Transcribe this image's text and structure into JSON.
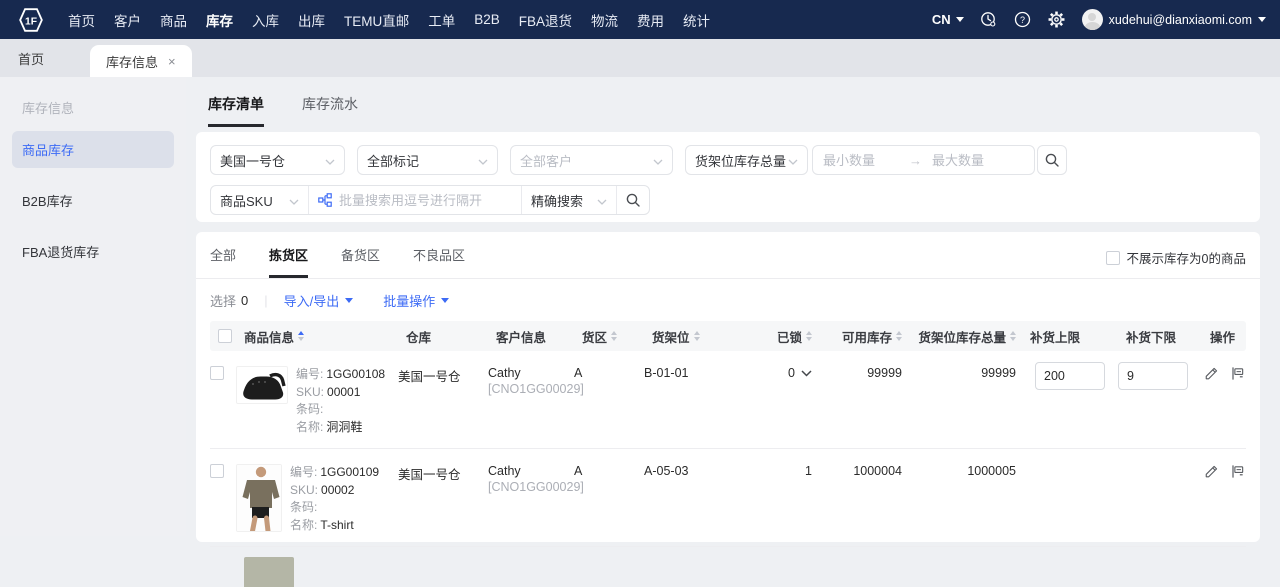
{
  "colors": {
    "accent": "#3d6bf5",
    "navbar_bg": "#17294f"
  },
  "navbar": {
    "logo_text": "1F",
    "items": [
      "首页",
      "客户",
      "商品",
      "库存",
      "入库",
      "出库",
      "TEMU直邮",
      "工单",
      "B2B",
      "FBA退货",
      "物流",
      "费用",
      "统计"
    ],
    "active_item": "库存",
    "lang": "CN",
    "user_email": "xudehui@dianxiaomi.com"
  },
  "tabbar": {
    "home_tab": "首页",
    "active_tab": "库存信息",
    "close_glyph": "×"
  },
  "sidebar": {
    "title": "库存信息",
    "items": [
      {
        "label": "商品库存",
        "active": true
      },
      {
        "label": "B2B库存",
        "active": false
      },
      {
        "label": "FBA退货库存",
        "active": false
      }
    ]
  },
  "main": {
    "tabs": [
      {
        "label": "库存清单",
        "active": true
      },
      {
        "label": "库存流水",
        "active": false
      }
    ],
    "filters": {
      "warehouse_value": "美国一号仓",
      "mark_value": "全部标记",
      "customer_placeholder": "全部客户",
      "qty_type_value": "货架位库存总量",
      "min_placeholder": "最小数量",
      "max_placeholder": "最大数量",
      "range_arrow": "→",
      "sku_value": "商品SKU",
      "batch_placeholder": "批量搜索用逗号进行隔开",
      "match_value": "精确搜索"
    },
    "zone_tabs": [
      {
        "label": "全部",
        "active": false
      },
      {
        "label": "拣货区",
        "active": true
      },
      {
        "label": "备货区",
        "active": false
      },
      {
        "label": "不良品区",
        "active": false
      }
    ],
    "hide_zero_label": "不展示库存为0的商品",
    "toolbar": {
      "selected_label": "选择",
      "selected_count": "0",
      "import_export_label": "导入/导出",
      "batch_ops_label": "批量操作"
    },
    "table": {
      "headers": [
        {
          "label": "商品信息",
          "sort": "asc"
        },
        {
          "label": "仓库"
        },
        {
          "label": "客户信息"
        },
        {
          "label": "货区",
          "sort": true
        },
        {
          "label": "货架位",
          "sort": true
        },
        {
          "label": "已锁",
          "sort": true
        },
        {
          "label": "可用库存",
          "sort": true
        },
        {
          "label": "货架位库存总量",
          "sort": true
        },
        {
          "label": "补货上限"
        },
        {
          "label": "补货下限"
        },
        {
          "label": "操作"
        }
      ],
      "row_labels": {
        "number": "编号:",
        "sku": "SKU:",
        "barcode": "条码:",
        "name": "名称:"
      },
      "rows": [
        {
          "image_alt": "黑色洞洞鞋",
          "number": "1GG00108",
          "sku": "00001",
          "barcode": "",
          "name": "洞洞鞋",
          "warehouse": "美国一号仓",
          "customer_name": "Cathy",
          "customer_code": "[CNO1GG00029]",
          "zone": "A",
          "shelf": "B-01-01",
          "locked": "0",
          "available": "99999",
          "total": "99999",
          "restock_upper": "200",
          "restock_lower": "9"
        },
        {
          "image_alt": "模特穿T恤",
          "number": "1GG00109",
          "sku": "00002",
          "barcode": "",
          "name": "T-shirt",
          "warehouse": "美国一号仓",
          "customer_name": "Cathy",
          "customer_code": "[CNO1GG00029]",
          "zone": "A",
          "shelf": "A-05-03",
          "locked": "1",
          "available": "1000004",
          "total": "1000005",
          "restock_upper": "",
          "restock_lower": ""
        }
      ]
    }
  }
}
